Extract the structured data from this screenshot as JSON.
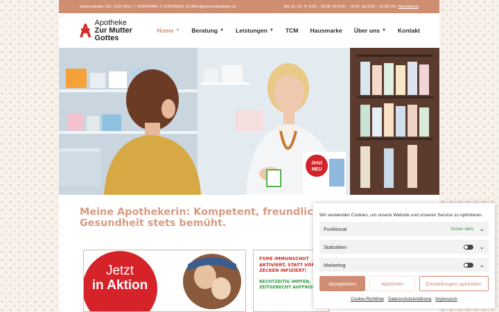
{
  "topbar": {
    "contact": "Gudrunstraße 150, 1100 Wien, T 01/6043494, F 01/6025590, M office@apomuttergottes.at",
    "hours": "Mo, Di, Do, Fr 8.00 – 18.00, Mi 8.00 – 19.00, Sa 8.00 – 12.00 Uhr,",
    "hours_link": "Nachtdienst"
  },
  "logo": {
    "line1": "Apotheke",
    "line2": "Zur Mutter Gottes"
  },
  "nav": {
    "items": [
      {
        "label": "Home",
        "active": true,
        "dropdown": true
      },
      {
        "label": "Beratung",
        "active": false,
        "dropdown": true
      },
      {
        "label": "Leistungen",
        "active": false,
        "dropdown": true
      },
      {
        "label": "TCM",
        "active": false,
        "dropdown": false
      },
      {
        "label": "Hausmarke",
        "active": false,
        "dropdown": false
      },
      {
        "label": "Über uns",
        "active": false,
        "dropdown": true
      },
      {
        "label": "Kontakt",
        "active": false,
        "dropdown": false
      }
    ]
  },
  "hero": {
    "sign_text_1": "Jetzt",
    "sign_text_2": "NEU"
  },
  "headline": {
    "line1": "Meine Apothekerin: Kompetent, freundlich u",
    "line2": "Gesundheit stets bemüht."
  },
  "promo1": {
    "badge_line1": "Jetzt",
    "badge_line2": "in Aktion"
  },
  "promo2": {
    "red_lines": "FSME IMMUNSCHUT AKTIVIERT, STATT VON ZECKEN INFIZIERT!",
    "green_lines": "RECHTZEITIG IMPFEN, ZEITGERECHT AUFFRISCHE"
  },
  "cookie": {
    "message": "Wir verwenden Cookies, um unsere Website und unseren Service zu optimieren.",
    "categories": [
      {
        "label": "Funktional",
        "status": "Immer aktiv"
      },
      {
        "label": "Statistiken",
        "status": ""
      },
      {
        "label": "Marketing",
        "status": ""
      }
    ],
    "accept": "Akzeptieren",
    "deny": "Ablehnen",
    "settings": "Einstellungen speichern",
    "links": [
      "Cookie-Richtlinie",
      "Datenschutzerklärung",
      "Impressum"
    ]
  },
  "colors": {
    "accent": "#cf8d72",
    "headline": "#d79b82",
    "always_active": "#2c9a3c"
  }
}
